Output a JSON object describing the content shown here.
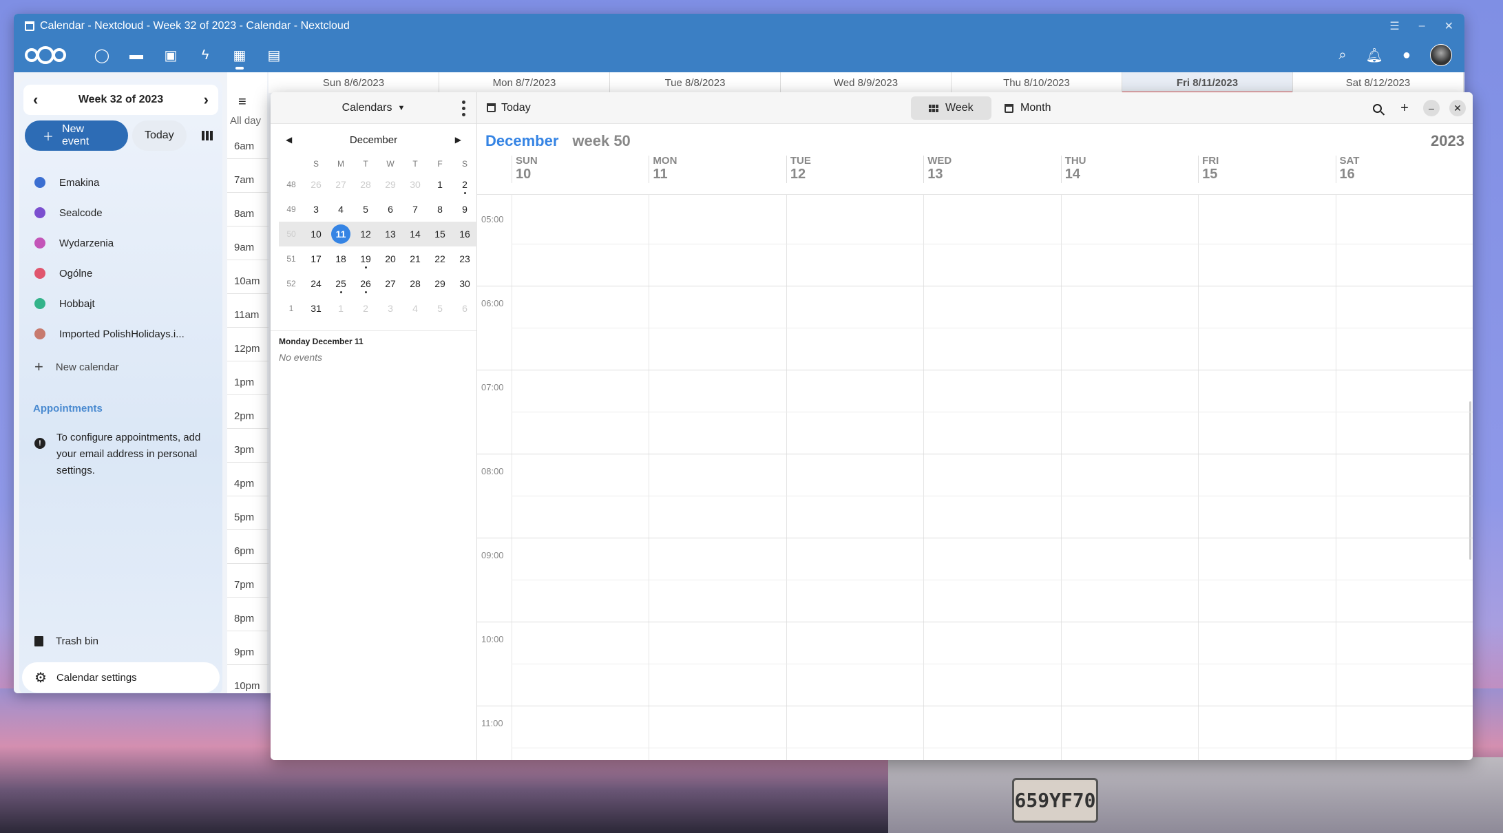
{
  "window": {
    "title": "Calendar - Nextcloud - Week 32 of 2023 - Calendar - Nextcloud"
  },
  "back_calendar": {
    "week_label": "Week 32 of 2023",
    "new_event": "New event",
    "today": "Today",
    "calendars": [
      {
        "name": "Emakina",
        "color": "#3b6fd1"
      },
      {
        "name": "Sealcode",
        "color": "#7b4fcf"
      },
      {
        "name": "Wydarzenia",
        "color": "#c355b8"
      },
      {
        "name": "Ogólne",
        "color": "#e0566e"
      },
      {
        "name": "Hobbajt",
        "color": "#33b38a"
      },
      {
        "name": "Imported PolishHolidays.i...",
        "color": "#c77a6e"
      }
    ],
    "new_calendar": "New calendar",
    "appointments_heading": "Appointments",
    "appointments_note": "To configure appointments, add your email address in personal settings.",
    "trash_bin": "Trash bin",
    "calendar_settings": "Calendar settings",
    "all_day": "All day",
    "hours": [
      "6am",
      "7am",
      "8am",
      "9am",
      "10am",
      "11am",
      "12pm",
      "1pm",
      "2pm",
      "3pm",
      "4pm",
      "5pm",
      "6pm",
      "7pm",
      "8pm",
      "9pm",
      "10pm"
    ],
    "day_headers": [
      "Sun 8/6/2023",
      "Mon 8/7/2023",
      "Tue 8/8/2023",
      "Wed 8/9/2023",
      "Thu 8/10/2023",
      "Fri 8/11/2023",
      "Sat 8/12/2023"
    ]
  },
  "front_calendar": {
    "calendars_menu": "Calendars",
    "month_name": "December",
    "dow": [
      "S",
      "M",
      "T",
      "W",
      "T",
      "F",
      "S"
    ],
    "weeks": [
      {
        "wk": "48",
        "days": [
          "26",
          "27",
          "28",
          "29",
          "30",
          "1",
          "2"
        ]
      },
      {
        "wk": "49",
        "days": [
          "3",
          "4",
          "5",
          "6",
          "7",
          "8",
          "9"
        ]
      },
      {
        "wk": "50",
        "days": [
          "10",
          "11",
          "12",
          "13",
          "14",
          "15",
          "16"
        ]
      },
      {
        "wk": "51",
        "days": [
          "17",
          "18",
          "19",
          "20",
          "21",
          "22",
          "23"
        ]
      },
      {
        "wk": "52",
        "days": [
          "24",
          "25",
          "26",
          "27",
          "28",
          "29",
          "30"
        ]
      },
      {
        "wk": "1",
        "days": [
          "31",
          "1",
          "2",
          "3",
          "4",
          "5",
          "6"
        ]
      }
    ],
    "selected_day_label": "Monday December 11",
    "no_events": "No events",
    "today_button": "Today",
    "week_button": "Week",
    "month_button": "Month",
    "title_month": "December",
    "title_week": "week 50",
    "year": "2023",
    "days": [
      {
        "name": "SUN",
        "num": "10"
      },
      {
        "name": "MON",
        "num": "11"
      },
      {
        "name": "TUE",
        "num": "12"
      },
      {
        "name": "WED",
        "num": "13"
      },
      {
        "name": "THU",
        "num": "14"
      },
      {
        "name": "FRI",
        "num": "15"
      },
      {
        "name": "SAT",
        "num": "16"
      }
    ],
    "times": [
      "05:00",
      "06:00",
      "07:00",
      "08:00",
      "09:00",
      "10:00",
      "11:00"
    ]
  }
}
